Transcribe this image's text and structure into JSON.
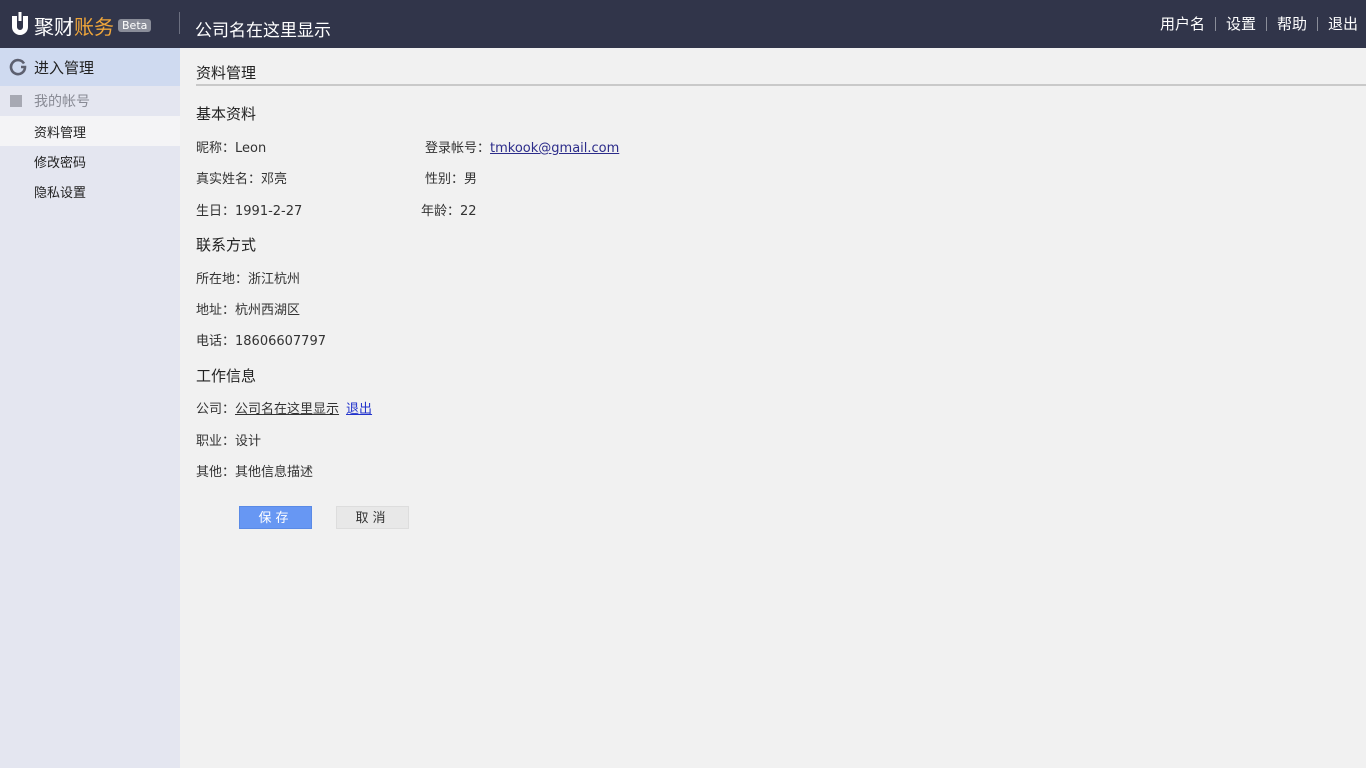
{
  "app": {
    "name_part1": "聚财",
    "name_part2": "账务",
    "beta": "Beta",
    "company_title": "公司名在这里显示"
  },
  "topnav": [
    "用户名",
    "设置",
    "帮助",
    "退出"
  ],
  "sidebar": {
    "head": "进入管理",
    "group": "我的帐号",
    "items": [
      "资料管理",
      "修改密码",
      "隐私设置"
    ],
    "active_index": 0
  },
  "page": {
    "title": "资料管理"
  },
  "basic": {
    "title": "基本资料",
    "nickname_label": "昵称：",
    "nickname": "Leon",
    "login_label": "登录帐号：",
    "login": "tmkook@gmail.com",
    "realname_label": "真实姓名：",
    "realname": "邓亮",
    "gender_label": "性别：",
    "gender": "男",
    "birthday_label": "生日：",
    "birthday": "1991-2-27",
    "age_label": "年龄：",
    "age": "22"
  },
  "contact": {
    "title": "联系方式",
    "location_label": "所在地：",
    "location": "浙江杭州",
    "address_label": "地址：",
    "address": "杭州西湖区",
    "phone_label": "电话：",
    "phone": "18606607797"
  },
  "work": {
    "title": "工作信息",
    "company_label": "公司：",
    "company": "公司名在这里显示",
    "company_exit": "退出",
    "job_label": "职业：",
    "job": "设计",
    "other_label": "其他：",
    "other": "其他信息描述"
  },
  "buttons": {
    "save": "保存",
    "cancel": "取消"
  },
  "colors": {
    "topbar": "#31354a",
    "accent_orange": "#f0a63a",
    "save_button": "#6797f3",
    "sidebar_head": "#cfdaf0",
    "sidebar": "#e4e6f0"
  }
}
